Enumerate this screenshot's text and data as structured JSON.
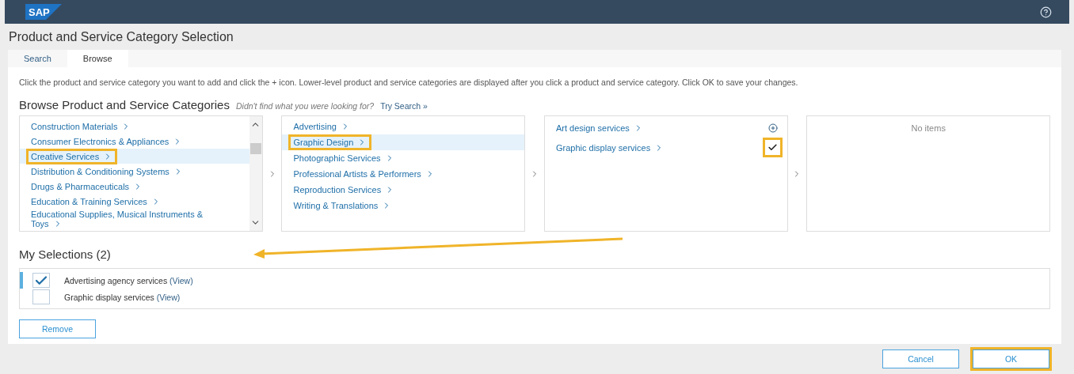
{
  "logo": "SAP",
  "title": "Product and Service Category Selection",
  "tabs": [
    {
      "label": "Search",
      "selected": false
    },
    {
      "label": "Browse",
      "selected": true
    }
  ],
  "instructions": "Click the product and service category you want to add and click the + icon. Lower-level product and service categories are displayed after you click a product and service category. Click OK to save your changes.",
  "browse": {
    "heading": "Browse Product and Service Categories",
    "hint": "Didn't find what you were looking for?",
    "link": "Try Search »"
  },
  "columns": [
    {
      "scrollable": true,
      "items": [
        {
          "label": "Construction Materials",
          "selected": false,
          "highlighted": false
        },
        {
          "label": "Consumer Electronics & Appliances",
          "selected": false,
          "highlighted": false
        },
        {
          "label": "Creative Services",
          "selected": true,
          "highlighted": true
        },
        {
          "label": "Distribution & Conditioning Systems",
          "selected": false,
          "highlighted": false
        },
        {
          "label": "Drugs & Pharmaceuticals",
          "selected": false,
          "highlighted": false
        },
        {
          "label": "Education & Training Services",
          "selected": false,
          "highlighted": false
        },
        {
          "label": "Educational Supplies, Musical Instruments & Toys",
          "selected": false,
          "highlighted": false
        }
      ]
    },
    {
      "scrollable": false,
      "items": [
        {
          "label": "Advertising",
          "selected": false,
          "highlighted": false
        },
        {
          "label": "Graphic Design",
          "selected": true,
          "highlighted": true
        },
        {
          "label": "Photographic Services",
          "selected": false,
          "highlighted": false
        },
        {
          "label": "Professional Artists & Performers",
          "selected": false,
          "highlighted": false
        },
        {
          "label": "Reproduction Services",
          "selected": false,
          "highlighted": false
        },
        {
          "label": "Writing & Translations",
          "selected": false,
          "highlighted": false
        }
      ]
    },
    {
      "scrollable": false,
      "items": [
        {
          "label": "Art design services",
          "selected": false,
          "highlighted": false,
          "kind": "add",
          "action_highlighted": false
        },
        {
          "label": "Graphic display services",
          "selected": false,
          "highlighted": false,
          "kind": "added",
          "action_highlighted": true
        }
      ]
    },
    {
      "scrollable": false,
      "empty": "No items"
    }
  ],
  "selections": {
    "heading": "My Selections (2)",
    "items": [
      {
        "label": "Advertising agency services",
        "link": "(View)",
        "checked": true,
        "selected": true
      },
      {
        "label": "Graphic display services",
        "link": "(View)",
        "checked": false,
        "selected": false
      }
    ]
  },
  "remove_button": "Remove",
  "buttons": [
    {
      "label": "Cancel",
      "highlighted": false
    },
    {
      "label": "OK",
      "highlighted": true
    }
  ]
}
